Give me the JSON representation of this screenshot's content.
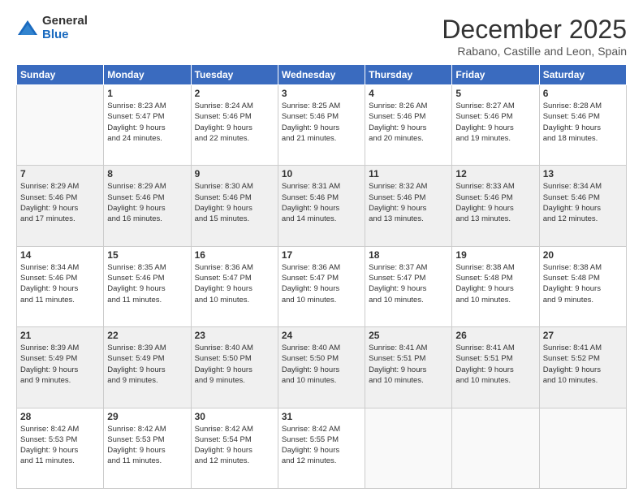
{
  "logo": {
    "general": "General",
    "blue": "Blue"
  },
  "header": {
    "month": "December 2025",
    "location": "Rabano, Castille and Leon, Spain"
  },
  "weekdays": [
    "Sunday",
    "Monday",
    "Tuesday",
    "Wednesday",
    "Thursday",
    "Friday",
    "Saturday"
  ],
  "weeks": [
    [
      {
        "day": "",
        "lines": []
      },
      {
        "day": "1",
        "lines": [
          "Sunrise: 8:23 AM",
          "Sunset: 5:47 PM",
          "Daylight: 9 hours",
          "and 24 minutes."
        ]
      },
      {
        "day": "2",
        "lines": [
          "Sunrise: 8:24 AM",
          "Sunset: 5:46 PM",
          "Daylight: 9 hours",
          "and 22 minutes."
        ]
      },
      {
        "day": "3",
        "lines": [
          "Sunrise: 8:25 AM",
          "Sunset: 5:46 PM",
          "Daylight: 9 hours",
          "and 21 minutes."
        ]
      },
      {
        "day": "4",
        "lines": [
          "Sunrise: 8:26 AM",
          "Sunset: 5:46 PM",
          "Daylight: 9 hours",
          "and 20 minutes."
        ]
      },
      {
        "day": "5",
        "lines": [
          "Sunrise: 8:27 AM",
          "Sunset: 5:46 PM",
          "Daylight: 9 hours",
          "and 19 minutes."
        ]
      },
      {
        "day": "6",
        "lines": [
          "Sunrise: 8:28 AM",
          "Sunset: 5:46 PM",
          "Daylight: 9 hours",
          "and 18 minutes."
        ]
      }
    ],
    [
      {
        "day": "7",
        "lines": [
          "Sunrise: 8:29 AM",
          "Sunset: 5:46 PM",
          "Daylight: 9 hours",
          "and 17 minutes."
        ]
      },
      {
        "day": "8",
        "lines": [
          "Sunrise: 8:29 AM",
          "Sunset: 5:46 PM",
          "Daylight: 9 hours",
          "and 16 minutes."
        ]
      },
      {
        "day": "9",
        "lines": [
          "Sunrise: 8:30 AM",
          "Sunset: 5:46 PM",
          "Daylight: 9 hours",
          "and 15 minutes."
        ]
      },
      {
        "day": "10",
        "lines": [
          "Sunrise: 8:31 AM",
          "Sunset: 5:46 PM",
          "Daylight: 9 hours",
          "and 14 minutes."
        ]
      },
      {
        "day": "11",
        "lines": [
          "Sunrise: 8:32 AM",
          "Sunset: 5:46 PM",
          "Daylight: 9 hours",
          "and 13 minutes."
        ]
      },
      {
        "day": "12",
        "lines": [
          "Sunrise: 8:33 AM",
          "Sunset: 5:46 PM",
          "Daylight: 9 hours",
          "and 13 minutes."
        ]
      },
      {
        "day": "13",
        "lines": [
          "Sunrise: 8:34 AM",
          "Sunset: 5:46 PM",
          "Daylight: 9 hours",
          "and 12 minutes."
        ]
      }
    ],
    [
      {
        "day": "14",
        "lines": [
          "Sunrise: 8:34 AM",
          "Sunset: 5:46 PM",
          "Daylight: 9 hours",
          "and 11 minutes."
        ]
      },
      {
        "day": "15",
        "lines": [
          "Sunrise: 8:35 AM",
          "Sunset: 5:46 PM",
          "Daylight: 9 hours",
          "and 11 minutes."
        ]
      },
      {
        "day": "16",
        "lines": [
          "Sunrise: 8:36 AM",
          "Sunset: 5:47 PM",
          "Daylight: 9 hours",
          "and 10 minutes."
        ]
      },
      {
        "day": "17",
        "lines": [
          "Sunrise: 8:36 AM",
          "Sunset: 5:47 PM",
          "Daylight: 9 hours",
          "and 10 minutes."
        ]
      },
      {
        "day": "18",
        "lines": [
          "Sunrise: 8:37 AM",
          "Sunset: 5:47 PM",
          "Daylight: 9 hours",
          "and 10 minutes."
        ]
      },
      {
        "day": "19",
        "lines": [
          "Sunrise: 8:38 AM",
          "Sunset: 5:48 PM",
          "Daylight: 9 hours",
          "and 10 minutes."
        ]
      },
      {
        "day": "20",
        "lines": [
          "Sunrise: 8:38 AM",
          "Sunset: 5:48 PM",
          "Daylight: 9 hours",
          "and 9 minutes."
        ]
      }
    ],
    [
      {
        "day": "21",
        "lines": [
          "Sunrise: 8:39 AM",
          "Sunset: 5:49 PM",
          "Daylight: 9 hours",
          "and 9 minutes."
        ]
      },
      {
        "day": "22",
        "lines": [
          "Sunrise: 8:39 AM",
          "Sunset: 5:49 PM",
          "Daylight: 9 hours",
          "and 9 minutes."
        ]
      },
      {
        "day": "23",
        "lines": [
          "Sunrise: 8:40 AM",
          "Sunset: 5:50 PM",
          "Daylight: 9 hours",
          "and 9 minutes."
        ]
      },
      {
        "day": "24",
        "lines": [
          "Sunrise: 8:40 AM",
          "Sunset: 5:50 PM",
          "Daylight: 9 hours",
          "and 10 minutes."
        ]
      },
      {
        "day": "25",
        "lines": [
          "Sunrise: 8:41 AM",
          "Sunset: 5:51 PM",
          "Daylight: 9 hours",
          "and 10 minutes."
        ]
      },
      {
        "day": "26",
        "lines": [
          "Sunrise: 8:41 AM",
          "Sunset: 5:51 PM",
          "Daylight: 9 hours",
          "and 10 minutes."
        ]
      },
      {
        "day": "27",
        "lines": [
          "Sunrise: 8:41 AM",
          "Sunset: 5:52 PM",
          "Daylight: 9 hours",
          "and 10 minutes."
        ]
      }
    ],
    [
      {
        "day": "28",
        "lines": [
          "Sunrise: 8:42 AM",
          "Sunset: 5:53 PM",
          "Daylight: 9 hours",
          "and 11 minutes."
        ]
      },
      {
        "day": "29",
        "lines": [
          "Sunrise: 8:42 AM",
          "Sunset: 5:53 PM",
          "Daylight: 9 hours",
          "and 11 minutes."
        ]
      },
      {
        "day": "30",
        "lines": [
          "Sunrise: 8:42 AM",
          "Sunset: 5:54 PM",
          "Daylight: 9 hours",
          "and 12 minutes."
        ]
      },
      {
        "day": "31",
        "lines": [
          "Sunrise: 8:42 AM",
          "Sunset: 5:55 PM",
          "Daylight: 9 hours",
          "and 12 minutes."
        ]
      },
      {
        "day": "",
        "lines": []
      },
      {
        "day": "",
        "lines": []
      },
      {
        "day": "",
        "lines": []
      }
    ]
  ]
}
